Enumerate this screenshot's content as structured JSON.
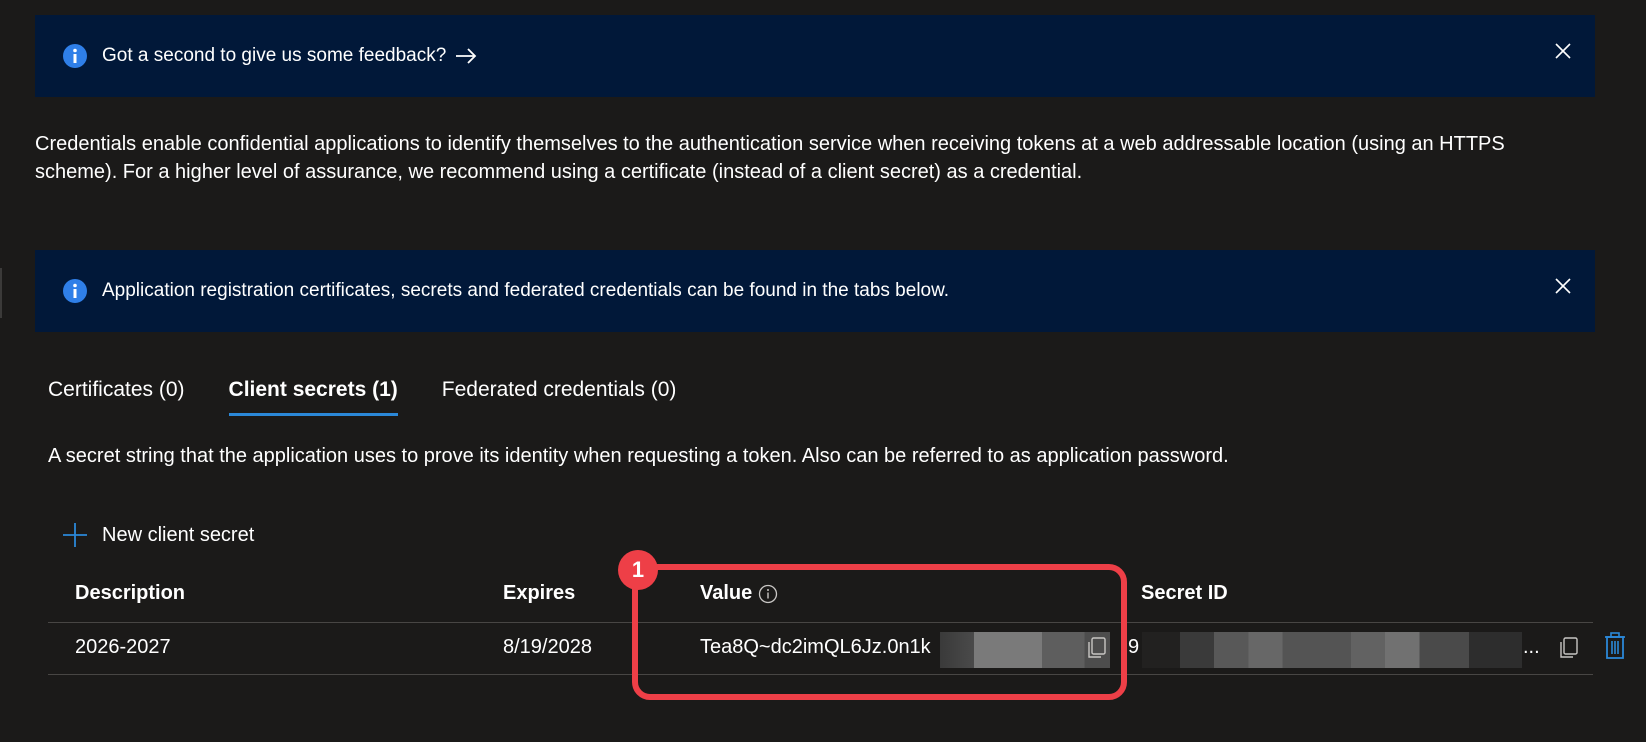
{
  "banners": {
    "feedback": {
      "text": "Got a second to give us some feedback?"
    },
    "tabs_info": {
      "text": "Application registration certificates, secrets and federated credentials can be found in the tabs below."
    }
  },
  "description": "Credentials enable confidential applications to identify themselves to the authentication service when receiving tokens at a web addressable location (using an HTTPS scheme). For a higher level of assurance, we recommend using a certificate (instead of a client secret) as a credential.",
  "tabs": [
    {
      "label": "Certificates (0)",
      "active": false
    },
    {
      "label": "Client secrets (1)",
      "active": true
    },
    {
      "label": "Federated credentials (0)",
      "active": false
    }
  ],
  "client_secrets": {
    "description": "A secret string that the application uses to prove its identity when requesting a token. Also can be referred to as application password.",
    "new_label": "New client secret",
    "columns": {
      "description": "Description",
      "expires": "Expires",
      "value": "Value",
      "secret_id": "Secret ID"
    },
    "rows": [
      {
        "description": "2026-2027",
        "expires": "8/19/2028",
        "value": "Tea8Q~dc2imQL6Jz.0n1k",
        "secret_id": "9",
        "secret_id_suffix": "..."
      }
    ]
  },
  "annotation": {
    "number": "1",
    "color": "#ee3f47"
  },
  "colors": {
    "background": "#1b1a19",
    "banner": "#011839",
    "accent": "#2b88d8",
    "info_icon": "#2f7fe8"
  }
}
